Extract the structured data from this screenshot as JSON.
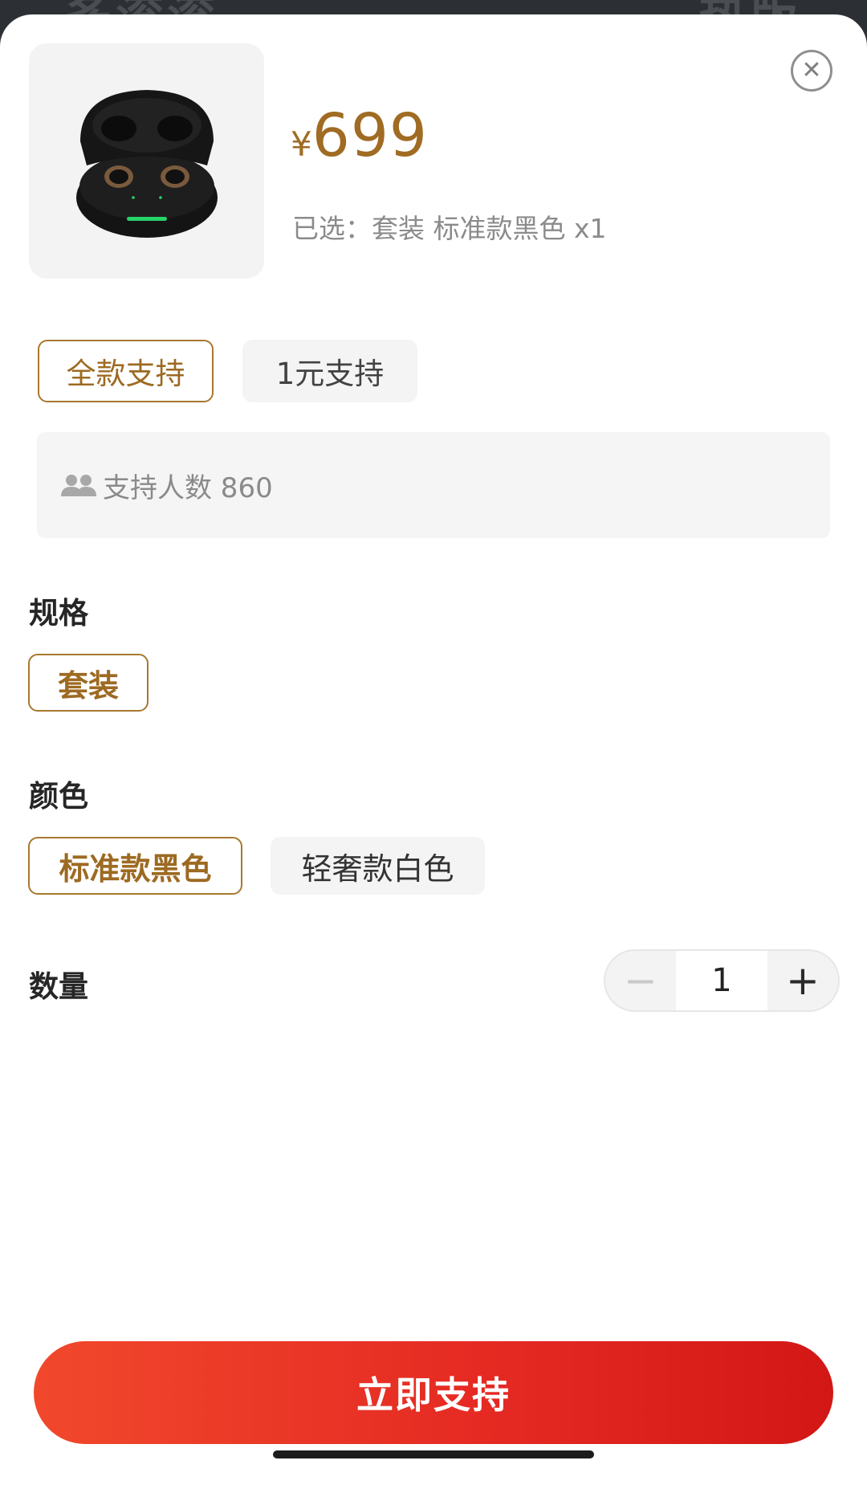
{
  "backdrop": {
    "left_text": "多滚滚",
    "right_text": "热版"
  },
  "product": {
    "price_currency": "¥",
    "price_value": "699",
    "selected_text": "已选：套装 标准款黑色 x1"
  },
  "support_tabs": [
    {
      "label": "全款支持",
      "active": true
    },
    {
      "label": "1元支持",
      "active": false
    }
  ],
  "supporters": {
    "text": "支持人数 860",
    "icon": "people-icon"
  },
  "spec": {
    "title": "规格",
    "options": [
      {
        "label": "套装",
        "active": true
      }
    ]
  },
  "color": {
    "title": "颜色",
    "options": [
      {
        "label": "标准款黑色",
        "active": true
      },
      {
        "label": "轻奢款白色",
        "active": false
      }
    ]
  },
  "quantity": {
    "title": "数量",
    "value": "1",
    "minus": "−",
    "plus": "+"
  },
  "cta": {
    "label": "立即支持"
  },
  "colors": {
    "accent": "#a06b22",
    "cta_start": "#f1482c",
    "cta_end": "#d21715"
  }
}
